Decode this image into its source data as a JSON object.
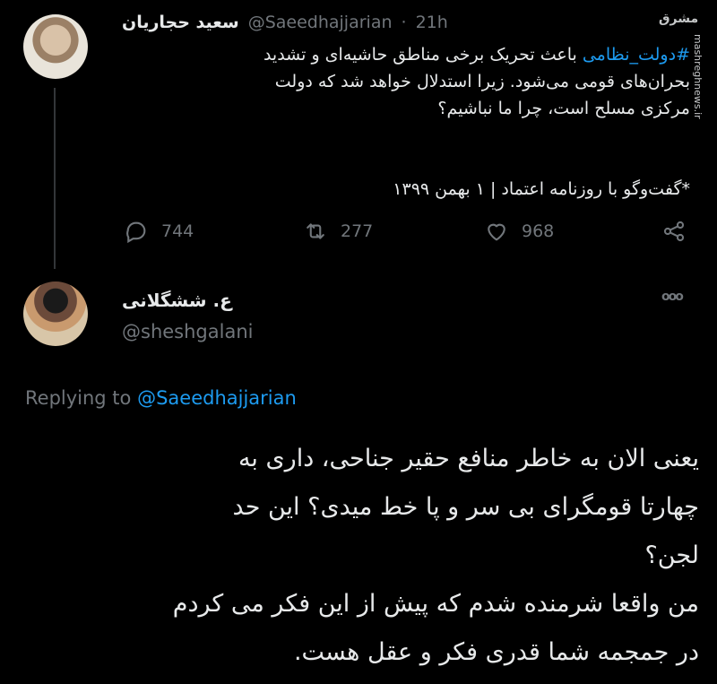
{
  "watermark": {
    "logo_text": "مشرق",
    "site": "mashreghnews.ir"
  },
  "original_tweet": {
    "author_name": "سعید حجاریان",
    "author_handle": "@Saeedhajjarian",
    "separator": "·",
    "time": "21h",
    "hashtag": "#دولت_نظامی",
    "body_line1_rest": " باعث تحریک برخی مناطق حاشیه‌ای و تشدید",
    "body_line2": "بحران‌های قومی می‌شود. زیرا استدلال خواهد شد که دولت",
    "body_line3": "مرکزی مسلح است، چرا ما نباشیم؟",
    "source_line": "*گفت‌وگو با روزنامه اعتماد | ۱ بهمن ۱۳۹۹",
    "replies": "744",
    "retweets": "277",
    "likes": "968"
  },
  "reply_tweet": {
    "author_name": "ع. ششگلانی",
    "author_handle": "@sheshgalani",
    "more": "ooo",
    "replying_label": "Replying to",
    "replying_handle": "@Saeedhajjarian",
    "line1": "یعنی الان به خاطر منافع حقیر جناحی، داری به",
    "line2": "چهارتا قومگرای بی سر و پا خط میدی؟ این حد",
    "line3": "لجن؟",
    "line4": "من واقعا شرمنده شدم که پیش از این فکر می کردم",
    "line5": "در جمجمه شما قدری فکر و عقل هست."
  },
  "colors": {
    "background": "#000000",
    "text": "#e7e9ea",
    "muted": "#71767b",
    "accent": "#1d9bf0"
  },
  "icons": [
    "reply-icon",
    "retweet-icon",
    "like-icon",
    "share-icon"
  ]
}
